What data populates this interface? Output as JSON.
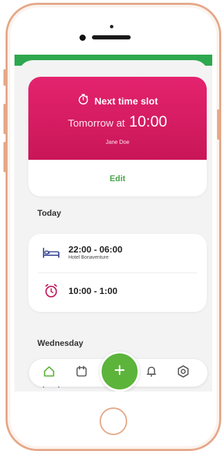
{
  "next_slot": {
    "title": "Next time slot",
    "prefix": "Tomorrow at",
    "time": "10:00",
    "person": "Jane Doe",
    "edit_label": "Edit"
  },
  "sections": {
    "today": "Today",
    "wednesday": "Wednesday"
  },
  "today_entries": [
    {
      "time": "22:00 - 06:00",
      "location": "Hotel Bonaventure",
      "icon": "bed-icon"
    },
    {
      "time": "10:00 - 1:00",
      "icon": "alarm-clock-icon"
    }
  ],
  "nav": {
    "items": [
      "home-icon",
      "calendar-icon",
      "add-icon",
      "bell-icon",
      "settings-icon"
    ]
  },
  "colors": {
    "accent_green": "#5cb43b",
    "header_pink": "#e4236e",
    "icon_blue": "#3d4a9a",
    "icon_pink": "#c2185b",
    "phone_frame": "#e5a888"
  }
}
